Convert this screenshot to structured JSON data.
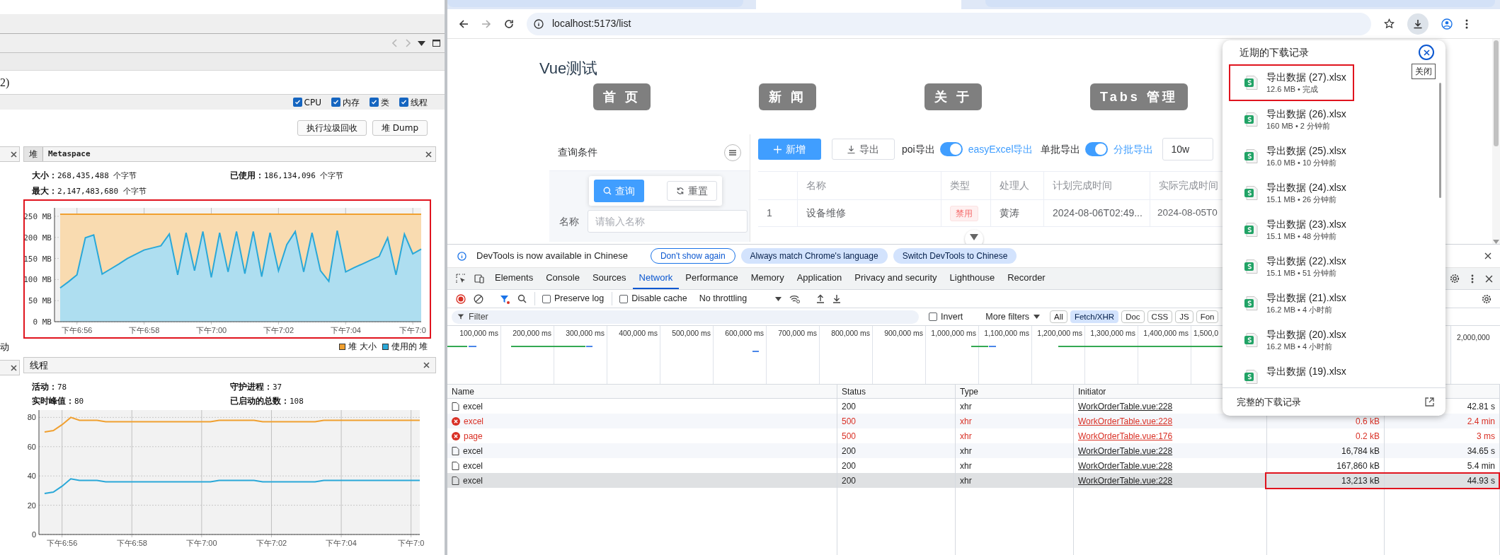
{
  "profiler": {
    "title_fragment": "2)",
    "options": [
      {
        "label": "CPU",
        "checked": true
      },
      {
        "label": "内存",
        "checked": true
      },
      {
        "label": "类",
        "checked": true
      },
      {
        "label": "线程",
        "checked": true
      }
    ],
    "buttons": [
      "执行垃圾回收",
      "堆 Dump"
    ],
    "heap_panel": {
      "tabs": [
        {
          "label": "堆",
          "selected": true
        },
        {
          "label": "Metaspace",
          "selected": false
        }
      ],
      "stats": [
        {
          "label": "大小：",
          "value": "268,435,488 个字节"
        },
        {
          "label": "已使用：",
          "value": "186,134,096 个字节"
        },
        {
          "label": "最大：",
          "value": "2,147,483,680 个字节"
        }
      ],
      "highlighted": true,
      "chart_data": {
        "type": "area",
        "categories": [
          null,
          null,
          "下午6:56",
          null,
          null,
          null,
          null,
          null,
          null,
          null,
          "下午6:58",
          null,
          null,
          null,
          null,
          null,
          null,
          null,
          "下午7:00",
          null,
          null,
          null,
          null,
          null,
          null,
          null,
          "下午7:02",
          null,
          null,
          null,
          null,
          null,
          null,
          null,
          "下午7:04",
          null,
          null,
          null,
          null,
          null,
          null,
          null,
          "下午7:0",
          null
        ],
        "series": [
          {
            "name": "堆 大小",
            "color": "#f0a030",
            "values": [
              255,
              255,
              255,
              255,
              255,
              255,
              255,
              255,
              255,
              255,
              255,
              255,
              255,
              255,
              255,
              255,
              255,
              255,
              255,
              255,
              255,
              255,
              255,
              255,
              255,
              255,
              255,
              255,
              255,
              255,
              255,
              255,
              255,
              255,
              255,
              255,
              255,
              255,
              255,
              255,
              255,
              255,
              255,
              255
            ]
          },
          {
            "name": "使用的 堆",
            "color": "#2aa8d8",
            "values": [
              80,
              95,
              111,
              199,
              206,
              113,
              125,
              137,
              150,
              160,
              170,
              175,
              180,
              208,
              111,
              211,
              121,
              214,
              105,
              211,
              118,
              214,
              114,
              214,
              107,
              211,
              121,
              183,
              214,
              118,
              211,
              121,
              96,
              216,
              118,
              128,
              137,
              146,
              155,
              199,
              111,
              208,
              161,
              172
            ]
          }
        ],
        "ylim": [
          0,
          270
        ],
        "grid": true,
        "yticks": [
          {
            "value": 0,
            "label": "0 MB"
          },
          {
            "value": 50,
            "label": "50 MB"
          },
          {
            "value": 100,
            "label": "100 MB"
          },
          {
            "value": 150,
            "label": "150 MB"
          },
          {
            "value": 200,
            "label": "200 MB"
          },
          {
            "value": 250,
            "label": "250 MB"
          }
        ]
      }
    },
    "side_fragment": "动",
    "threads_panel": {
      "title": "线程",
      "stats": [
        {
          "label": "活动：",
          "value": "78"
        },
        {
          "label": "守护进程：",
          "value": "37"
        },
        {
          "label": "实时峰值：",
          "value": "80"
        },
        {
          "label": "已启动的总数：",
          "value": "108"
        }
      ],
      "chart_data": {
        "type": "line",
        "categories": [
          null,
          null,
          "下午6:56",
          null,
          null,
          null,
          null,
          null,
          null,
          null,
          "下午6:58",
          null,
          null,
          null,
          null,
          null,
          null,
          null,
          "下午7:00",
          null,
          null,
          null,
          null,
          null,
          null,
          null,
          "下午7:02",
          null,
          null,
          null,
          null,
          null,
          null,
          null,
          "下午7:04",
          null,
          null,
          null,
          null,
          null,
          null,
          null,
          "下午7:0",
          null
        ],
        "series": [
          {
            "color": "#f0a030",
            "values": [
              70,
              71,
              75,
              80,
              78,
              78,
              78,
              77,
              77,
              77,
              77,
              77,
              77,
              77,
              77,
              77,
              77,
              77,
              77,
              77,
              78,
              78,
              78,
              78,
              78,
              77,
              77,
              77,
              77,
              77,
              77,
              77,
              78,
              78,
              78,
              78,
              78,
              78,
              78,
              78,
              78,
              78,
              78,
              78
            ]
          },
          {
            "color": "#2aa8d8",
            "values": [
              28,
              29,
              33,
              38,
              37,
              37,
              37,
              36,
              36,
              36,
              36,
              36,
              36,
              36,
              36,
              36,
              36,
              36,
              36,
              36,
              37,
              37,
              37,
              37,
              37,
              36,
              36,
              36,
              36,
              36,
              36,
              36,
              37,
              37,
              37,
              37,
              37,
              37,
              37,
              37,
              37,
              37,
              37,
              37
            ]
          }
        ],
        "ylim": [
          0,
          85
        ],
        "grid": true,
        "yticks": [
          0,
          20,
          40,
          60,
          80
        ]
      }
    }
  },
  "browser": {
    "tabs": [
      {
        "selected": false
      },
      {
        "selected": true
      },
      {
        "selected": false
      }
    ],
    "address": "localhost:5173/list",
    "page": {
      "title": "Vue测试",
      "nav": [
        "首 页",
        "新 闻",
        "关 于",
        "Tabs 管理"
      ],
      "query": {
        "title": "查询条件",
        "buttons": [
          {
            "label": "查询",
            "kind": "primary"
          },
          {
            "label": "重置",
            "kind": "plain"
          }
        ],
        "field": {
          "label": "名称",
          "placeholder": "请输入名称"
        }
      },
      "toolbar": {
        "add": "新增",
        "export": "导出",
        "switches": [
          {
            "label": "poi导出",
            "on": true,
            "option": "easyExcel导出"
          },
          {
            "label": "单批导出",
            "on": true,
            "option": "分批导出"
          }
        ],
        "batch_size": "10w"
      },
      "table": {
        "columns": [
          "名称",
          "类型",
          "处理人",
          "计划完成时间",
          "实际完成时间"
        ],
        "rows": [
          {
            "index": "1",
            "name": "设备维修",
            "type": "禁用",
            "handler": "黄涛",
            "planned": "2024-08-06T02:49...",
            "actual": "2024-08-05T0"
          }
        ]
      }
    },
    "downloads": {
      "title": "近期的下载记录",
      "tooltip": "关闭",
      "items": [
        {
          "name": "导出数据 (27).xlsx",
          "info": "12.6 MB • 完成",
          "highlighted": true
        },
        {
          "name": "导出数据 (26).xlsx",
          "info": "160 MB • 2 分钟前",
          "highlighted": false
        },
        {
          "name": "导出数据 (25).xlsx",
          "info": "16.0 MB • 10 分钟前",
          "highlighted": false
        },
        {
          "name": "导出数据 (24).xlsx",
          "info": "15.1 MB • 26 分钟前",
          "highlighted": false
        },
        {
          "name": "导出数据 (23).xlsx",
          "info": "15.1 MB • 48 分钟前",
          "highlighted": false
        },
        {
          "name": "导出数据 (22).xlsx",
          "info": "15.1 MB • 51 分钟前",
          "highlighted": false
        },
        {
          "name": "导出数据 (21).xlsx",
          "info": "16.2 MB • 4 小时前",
          "highlighted": false
        },
        {
          "name": "导出数据 (20).xlsx",
          "info": "16.2 MB • 4 小时前",
          "highlighted": false
        },
        {
          "name": "导出数据 (19).xlsx",
          "highlighted": false
        }
      ],
      "footer": "完整的下载记录"
    },
    "devtools": {
      "notice": {
        "text": "DevTools is now available in Chinese",
        "buttons": [
          "Don't show again",
          "Always match Chrome's language",
          "Switch DevTools to Chinese"
        ]
      },
      "tabs": [
        {
          "label": "Elements",
          "selected": false
        },
        {
          "label": "Console",
          "selected": false
        },
        {
          "label": "Sources",
          "selected": false
        },
        {
          "label": "Network",
          "selected": true
        },
        {
          "label": "Performance",
          "selected": false
        },
        {
          "label": "Memory",
          "selected": false
        },
        {
          "label": "Application",
          "selected": false
        },
        {
          "label": "Privacy and security",
          "selected": false
        },
        {
          "label": "Lighthouse",
          "selected": false
        },
        {
          "label": "Recorder",
          "selected": false
        }
      ],
      "options": [
        {
          "label": "Preserve log",
          "checked": false
        },
        {
          "label": "Disable cache",
          "checked": false
        }
      ],
      "throttling": "No throttling",
      "filter": {
        "placeholder": "Filter",
        "invert": {
          "label": "Invert",
          "checked": false
        },
        "more": "More filters",
        "chips": [
          {
            "label": "All",
            "selected": false
          },
          {
            "label": "Fetch/XHR",
            "selected": true
          },
          {
            "label": "Doc",
            "selected": false
          },
          {
            "label": "CSS",
            "selected": false
          },
          {
            "label": "JS",
            "selected": false
          },
          {
            "label": "Fon",
            "selected": false
          }
        ]
      },
      "overview_labels": [
        "100,000 ms",
        "200,000 ms",
        "300,000 ms",
        "400,000 ms",
        "500,000 ms",
        "600,000 ms",
        "700,000 ms",
        "800,000 ms",
        "900,000 ms",
        "1,000,000 ms",
        "1,100,000 ms",
        "1,200,000 ms",
        "1,300,000 ms",
        "1,400,000 ms",
        "1,500,0"
      ],
      "overview_end_label": "2,000,000",
      "columns": [
        "Name",
        "Status",
        "Type",
        "Initiator"
      ],
      "rows": [
        {
          "name": "excel",
          "status": "200",
          "type": "xhr",
          "initiator": "WorkOrderTable.vue:228",
          "time": "42.81 s",
          "error": false,
          "selected": false,
          "highlighted": false
        },
        {
          "name": "excel",
          "status": "500",
          "type": "xhr",
          "initiator": "WorkOrderTable.vue:228",
          "size": "0.6 kB",
          "time": "2.4 min",
          "error": true,
          "selected": false,
          "highlighted": false
        },
        {
          "name": "page",
          "status": "500",
          "type": "xhr",
          "initiator": "WorkOrderTable.vue:176",
          "size": "0.2 kB",
          "time": "3 ms",
          "error": true,
          "selected": false,
          "highlighted": false
        },
        {
          "name": "excel",
          "status": "200",
          "type": "xhr",
          "initiator": "WorkOrderTable.vue:228",
          "size": "16,784 kB",
          "time": "34.65 s",
          "error": false,
          "selected": false,
          "highlighted": false
        },
        {
          "name": "excel",
          "status": "200",
          "type": "xhr",
          "initiator": "WorkOrderTable.vue:228",
          "size": "167,860 kB",
          "time": "5.4 min",
          "error": false,
          "selected": false,
          "highlighted": false
        },
        {
          "name": "excel",
          "status": "200",
          "type": "xhr",
          "initiator": "WorkOrderTable.vue:228",
          "size": "13,213 kB",
          "time": "44.93 s",
          "error": false,
          "selected": true,
          "highlighted": true
        }
      ]
    }
  }
}
